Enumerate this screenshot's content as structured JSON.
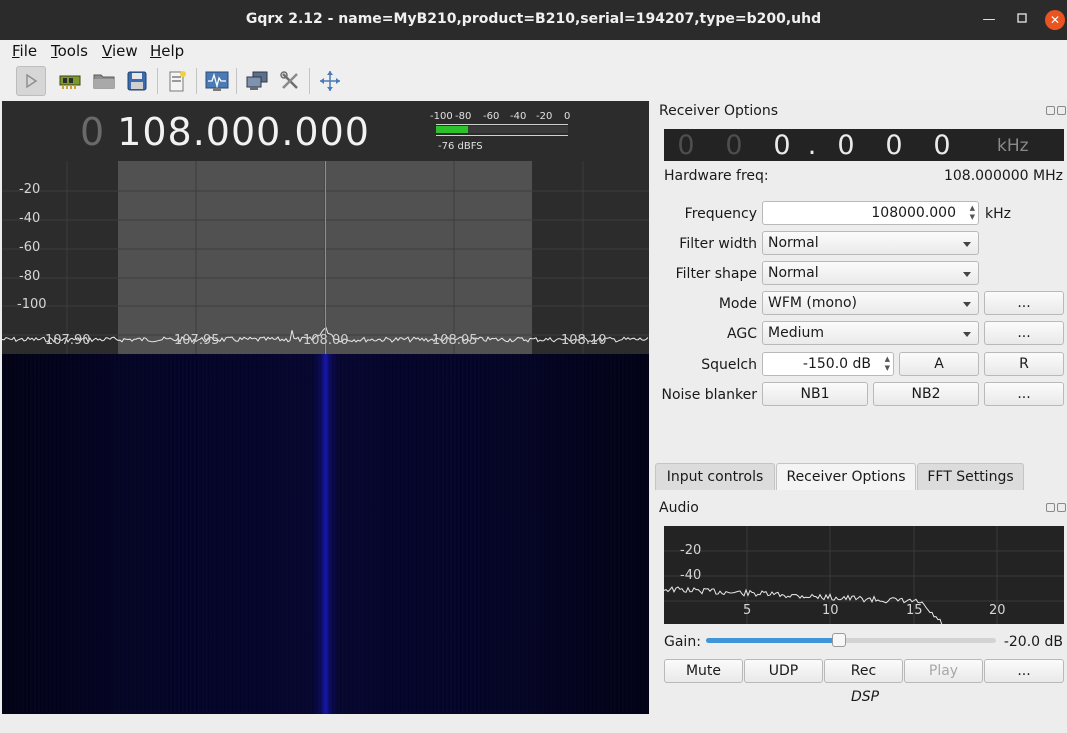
{
  "window": {
    "title": "Gqrx 2.12 - name=MyB210,product=B210,serial=194207,type=b200,uhd",
    "controls": [
      "minimize",
      "maximize",
      "close"
    ]
  },
  "menu": [
    {
      "label": "File",
      "key": "F",
      "rest": "ile"
    },
    {
      "label": "Tools",
      "key": "T",
      "rest": "ools"
    },
    {
      "label": "View",
      "key": "V",
      "rest": "iew"
    },
    {
      "label": "Help",
      "key": "H",
      "rest": "elp"
    }
  ],
  "toolbar": {
    "icons": [
      "play-icon",
      "hardware-icon",
      "open-folder-icon",
      "save-icon",
      "remote-control-icon",
      "io-config-icon",
      "network-icon",
      "settings-tools-icon",
      "center-align-icon"
    ]
  },
  "plot": {
    "freq_prefix": "0",
    "freq_value": "108.000.000",
    "meter_ticks": [
      "-100",
      "-80",
      "-60",
      "-40",
      "-20",
      "0"
    ],
    "meter_level": "-76 dBFS",
    "meter_fraction": 0.24,
    "y_labels": [
      "-20",
      "-40",
      "-60",
      "-80",
      "-100"
    ],
    "x_labels": [
      "107.90",
      "107.95",
      "108.00",
      "108.05",
      "108.10"
    ]
  },
  "receiver": {
    "dock_title": "Receiver Options",
    "lcd_digits": [
      "0",
      "0",
      "0",
      ".",
      "0",
      "0",
      "0"
    ],
    "lcd_dim": [
      true,
      true,
      false,
      false,
      false,
      false,
      false
    ],
    "lcd_unit": "kHz",
    "hw_freq_label": "Hardware freq:",
    "hw_freq_value": "108.000000 MHz",
    "frequency_label": "Frequency",
    "frequency_value": "108000.000",
    "frequency_unit": "kHz",
    "filter_width_label": "Filter width",
    "filter_width_value": "Normal",
    "filter_shape_label": "Filter shape",
    "filter_shape_value": "Normal",
    "mode_label": "Mode",
    "mode_value": "WFM (mono)",
    "mode_more": "...",
    "agc_label": "AGC",
    "agc_value": "Medium",
    "agc_more": "...",
    "squelch_label": "Squelch",
    "squelch_value": "-150.0 dB",
    "squelch_a": "A",
    "squelch_r": "R",
    "nb_label": "Noise blanker",
    "nb1": "NB1",
    "nb2": "NB2",
    "nb_more": "..."
  },
  "tabs": [
    {
      "label": "Input controls",
      "selected": false
    },
    {
      "label": "Receiver Options",
      "selected": true
    },
    {
      "label": "FFT Settings",
      "selected": false
    }
  ],
  "audio": {
    "dock_title": "Audio",
    "y_labels": [
      "-20",
      "-40"
    ],
    "x_labels": [
      "5",
      "10",
      "15",
      "20"
    ],
    "gain_label": "Gain:",
    "gain_value": "-20.0 dB",
    "gain_fraction": 0.46,
    "buttons": {
      "mute": "Mute",
      "udp": "UDP",
      "rec": "Rec",
      "play": "Play",
      "more": "..."
    },
    "dsp_label": "DSP"
  }
}
